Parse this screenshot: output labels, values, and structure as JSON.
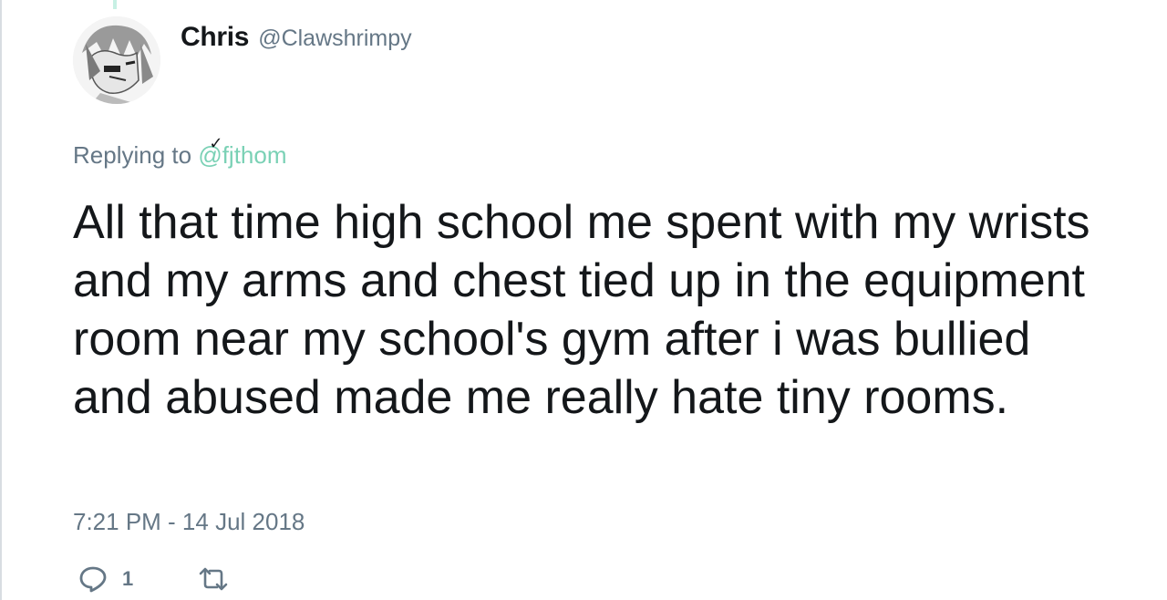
{
  "tweet": {
    "display_name": "Chris",
    "handle": "@Clawshrimpy",
    "replying_to_prefix": "Replying to",
    "replying_to_handle": "@fjthom",
    "text": "All that time high school me spent with my wrists and my arms and chest tied up in the equipment room near my school's gym after i was bullied and abused made me really hate tiny rooms.",
    "timestamp": "7:21 PM - 14 Jul 2018",
    "reply_count": "1",
    "icons": {
      "reply": "comment-icon",
      "retweet": "retweet-icon",
      "avatar": "avatar-anime-drawing"
    },
    "colors": {
      "text": "#14171a",
      "secondary": "#657786",
      "link": "#7ad1b5"
    }
  }
}
